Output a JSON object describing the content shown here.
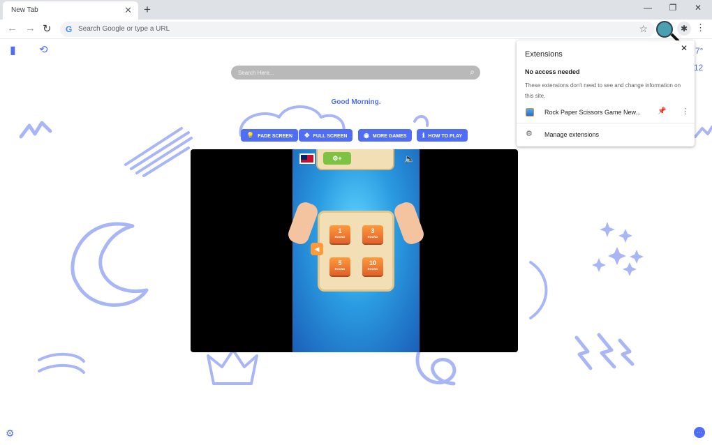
{
  "browser": {
    "tab_title": "New Tab",
    "tab_close": "✕",
    "new_tab": "+",
    "omnibox_placeholder": "Search Google or type a URL",
    "back": "←",
    "forward": "→",
    "reload": "↻",
    "minimize": "—",
    "restore": "❐",
    "close": "✕",
    "google_g": "G",
    "star": "☆",
    "puzzle": "✱",
    "menu": "⋮"
  },
  "page": {
    "search_placeholder": "Search Here...",
    "greeting": "Good Morning.",
    "buttons": {
      "fade_screen": "FADE SCREEN",
      "full_screen": "FULL SCREEN",
      "more_games": "MORE GAMES",
      "how_to_play": "HOW TO PLAY"
    },
    "weather_temp": "7°",
    "weather_other": "12"
  },
  "game": {
    "rounds": [
      {
        "number": "1",
        "label": "ROUND"
      },
      {
        "number": "3",
        "label": "ROUND"
      },
      {
        "number": "5",
        "label": "ROUND"
      },
      {
        "number": "10",
        "label": "ROUND"
      }
    ],
    "pill_text": "⚙+",
    "back": "◀",
    "sound": "🔈"
  },
  "extensions_popup": {
    "title": "Extensions",
    "close": "✕",
    "subtitle": "No access needed",
    "description": "These extensions don't need to see and change information on this site.",
    "item_name": "Rock Paper Scissors Game New...",
    "manage": "Manage extensions"
  },
  "colors": {
    "accent": "#4f6df5",
    "doodle": "#a9b6f6",
    "chrome_bg": "#dee1e6"
  }
}
